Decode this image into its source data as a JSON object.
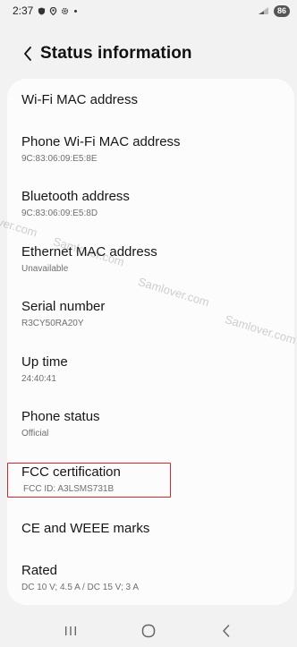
{
  "status_bar": {
    "time": "2:37",
    "battery": "86"
  },
  "header": {
    "title": "Status information"
  },
  "items": [
    {
      "label": "Wi-Fi MAC address",
      "value": ""
    },
    {
      "label": "Phone Wi-Fi MAC address",
      "value": "9C:83:06:09:E5:8E"
    },
    {
      "label": "Bluetooth address",
      "value": "9C:83:06:09:E5:8D"
    },
    {
      "label": "Ethernet MAC address",
      "value": "Unavailable"
    },
    {
      "label": "Serial number",
      "value": "R3CY50RA20Y"
    },
    {
      "label": "Up time",
      "value": "24:40:41"
    },
    {
      "label": "Phone status",
      "value": "Official"
    },
    {
      "label": "FCC certification",
      "value": "FCC ID: A3LSMS731B"
    },
    {
      "label": "CE and WEEE marks",
      "value": ""
    },
    {
      "label": "Rated",
      "value": "DC 10 V; 4.5 A / DC 15 V; 3 A"
    }
  ],
  "watermarks": [
    "ver.com",
    "Samlover.com",
    "Samlover.com",
    "Samlover.com"
  ],
  "colors": {
    "highlight_border": "#d6242c",
    "background": "#f2f2f2",
    "card": "#fcfcfc"
  },
  "icons": {
    "back": "chevron-left-icon",
    "nav_recents": "recents-icon",
    "nav_home": "home-icon",
    "nav_back": "back-icon"
  }
}
